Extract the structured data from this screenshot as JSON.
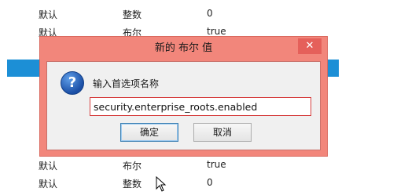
{
  "background_rows": [
    {
      "name": "默认",
      "type": "整数",
      "value": "0"
    },
    {
      "name": "默认",
      "type": "布尔",
      "value": "true"
    },
    {
      "name": "默认",
      "type": "布尔",
      "value": "true"
    },
    {
      "name": "默认",
      "type": "整数",
      "value": "0"
    }
  ],
  "dialog": {
    "title": "新的 布尔 值",
    "close_glyph": "✕",
    "prompt": "输入首选项名称",
    "input_value": "security.enterprise_roots.enabled",
    "ok_label": "确定",
    "cancel_label": "取消",
    "icon": "question-icon"
  },
  "colors": {
    "dialog_frame": "#f2867b",
    "close_button": "#e5605a",
    "selection_strip": "#1c8fd6",
    "input_border": "#d64040"
  }
}
